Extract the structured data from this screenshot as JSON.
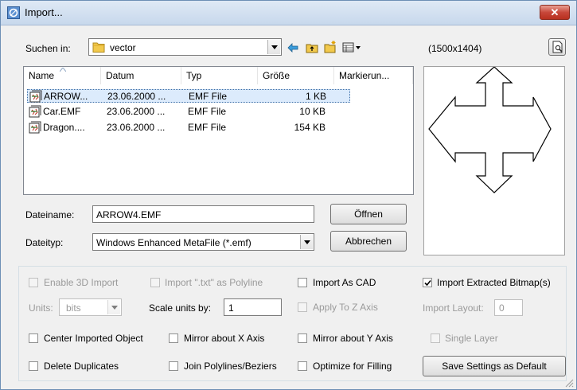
{
  "window": {
    "title": "Import...",
    "close_label": "✕"
  },
  "toolbar": {
    "look_in_label": "Suchen in:",
    "look_in_value": "vector",
    "resolution": "(1500x1404)"
  },
  "file_list": {
    "columns": [
      "Name",
      "Datum",
      "Typ",
      "Größe",
      "Markierun..."
    ],
    "rows": [
      {
        "name": "ARROW...",
        "date": "23.06.2000 ...",
        "type": "EMF File",
        "size": "1 KB",
        "selected": true
      },
      {
        "name": "Car.EMF",
        "date": "23.06.2000 ...",
        "type": "EMF File",
        "size": "10 KB",
        "selected": false
      },
      {
        "name": "Dragon....",
        "date": "23.06.2000 ...",
        "type": "EMF File",
        "size": "154 KB",
        "selected": false
      }
    ]
  },
  "filename": {
    "label": "Dateiname:",
    "value": "ARROW4.EMF",
    "open_button": "Öffnen"
  },
  "filetype": {
    "label": "Dateityp:",
    "value": "Windows Enhanced MetaFile (*.emf)",
    "cancel_button": "Abbrechen"
  },
  "options": {
    "enable_3d": "Enable 3D Import",
    "import_txt": "Import \".txt\" as Polyline",
    "import_cad": "Import As CAD",
    "import_bitmap": "Import Extracted Bitmap(s)",
    "units_label": "Units:",
    "units_value": "bits",
    "scale_label": "Scale units by:",
    "scale_value": "1",
    "apply_z": "Apply To Z Axis",
    "import_layout_label": "Import Layout:",
    "import_layout_value": "0",
    "center": "Center Imported Object",
    "mirror_x": "Mirror about X Axis",
    "mirror_y": "Mirror about Y Axis",
    "single_layer": "Single Layer",
    "delete_dup": "Delete Duplicates",
    "join_poly": "Join Polylines/Beziers",
    "optimize": "Optimize for Filling",
    "save_default": "Save Settings as Default"
  }
}
